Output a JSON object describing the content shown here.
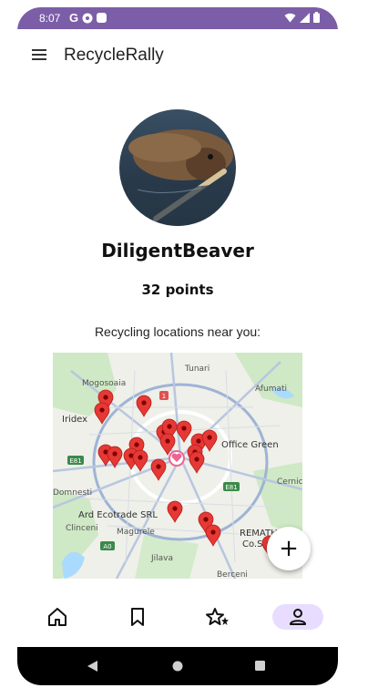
{
  "status": {
    "time": "8:07",
    "g_label": "G"
  },
  "app": {
    "title": "RecycleRally"
  },
  "profile": {
    "username": "DiligentBeaver",
    "points": "32 points"
  },
  "map": {
    "label": "Recycling locations near you:",
    "place_labels": [
      "Mogosoaia",
      "Iridex",
      "Tunari",
      "Afumati",
      "Office Green",
      "Domnesti",
      "Cernic",
      "Ard Ecotrade SRL",
      "Clinceni",
      "Magurele",
      "REMATHOLD",
      "Co.SRL",
      "Jilava",
      "Berceni",
      "E81",
      "E81",
      "A0",
      "1"
    ]
  },
  "fab": {
    "label": "+"
  },
  "nav": {
    "items": [
      "home",
      "saved",
      "rewards",
      "profile"
    ],
    "active": "profile"
  },
  "colors": {
    "status_bar": "#7b5ea7",
    "pin": "#e53935",
    "nav_active": "#e8ddff"
  }
}
